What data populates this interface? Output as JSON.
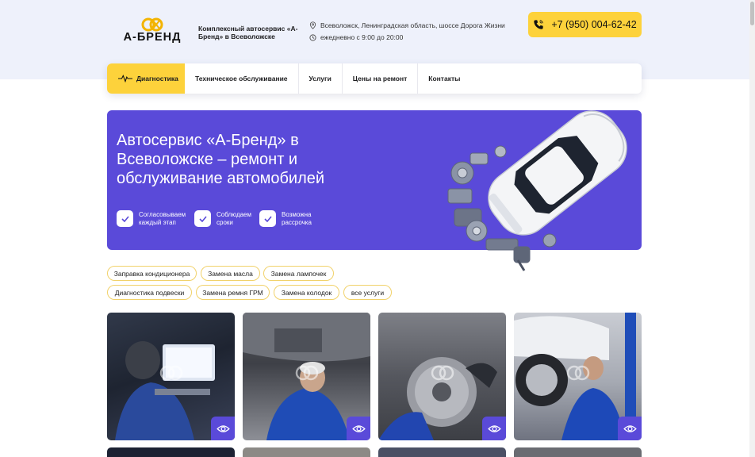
{
  "brand": {
    "logo_text": "А-БРЕНД",
    "tagline": "Комплексный автосервис «А-Бренд» в Всеволожске",
    "accent_color": "#fdd23b",
    "primary_color": "#5a4ad9"
  },
  "header": {
    "address": "Всеволожск, Ленинградская область, шоссе Дорога Жизни",
    "address_icon": "map-pin-icon",
    "hours": "ежедневно с 9:00 до 20:00",
    "hours_icon": "clock-icon",
    "phone": "+7 (950) 004-62-42",
    "phone_icon": "phone-icon"
  },
  "nav": {
    "items": [
      {
        "label": "Диагностика",
        "icon": "pulse-icon"
      },
      {
        "label": "Техническое обслуживание"
      },
      {
        "label": "Услуги"
      },
      {
        "label": "Цены на ремонт"
      },
      {
        "label": "Контакты"
      }
    ]
  },
  "hero": {
    "title": "Автосервис «А-Бренд» в Всеволожске – ремонт и обслуживание автомобилей",
    "features": [
      {
        "label": "Согласовываем каждый этап",
        "icon": "check-icon"
      },
      {
        "label": "Соблюдаем сроки",
        "icon": "check-icon"
      },
      {
        "label": "Возможна рассрочка",
        "icon": "check-icon"
      }
    ]
  },
  "tags": [
    "Заправка кондиционера",
    "Замена масла",
    "Замена лампочек",
    "Диагностика подвески",
    "Замена ремня ГРМ",
    "Замена колодок",
    "все услуги"
  ],
  "gallery": {
    "view_icon": "eye-icon",
    "photos": [
      "mechanic-laptop-diagnostics",
      "mechanic-under-car",
      "brake-disc-repair",
      "wheel-service"
    ]
  }
}
